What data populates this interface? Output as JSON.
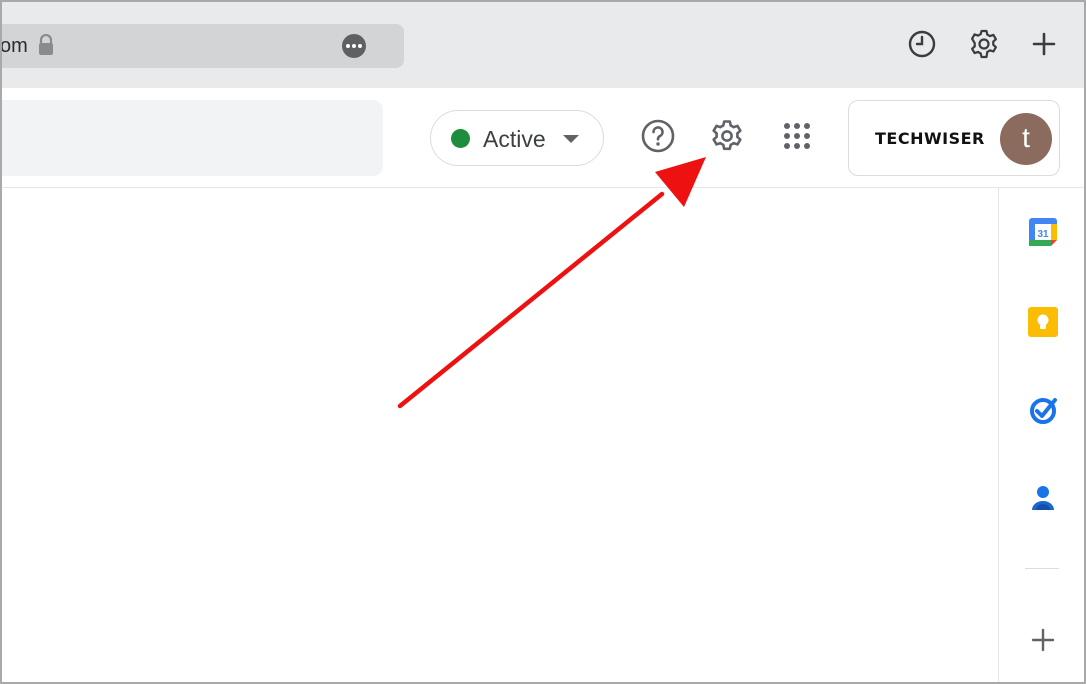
{
  "browser": {
    "url_text": "om",
    "icons": {
      "lock": "lock-icon",
      "more": "more-options-icon",
      "history": "history-icon",
      "settings": "gear-icon",
      "new_tab": "plus-icon"
    }
  },
  "header": {
    "status": {
      "label": "Active",
      "dot_color": "#1e8e3e"
    },
    "icons": {
      "help": "help-icon",
      "settings": "gear-icon",
      "apps": "apps-grid-icon"
    },
    "account": {
      "brand": "TECHWISER",
      "avatar_letter": "t",
      "avatar_color": "#8b6b5d"
    }
  },
  "side_panel": {
    "calendar_day": "31",
    "icons": [
      "calendar-icon",
      "keep-icon",
      "tasks-icon",
      "contacts-icon",
      "plus-icon"
    ]
  },
  "annotation": {
    "arrow_color": "#ee1111",
    "target": "settings-icon"
  }
}
